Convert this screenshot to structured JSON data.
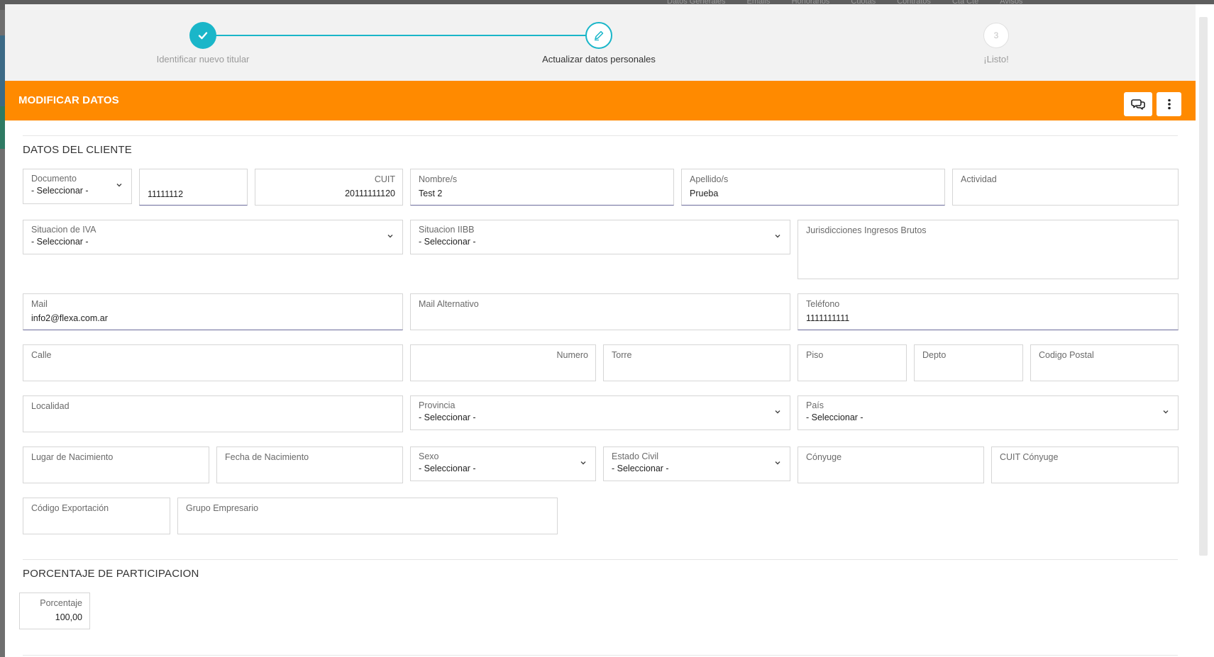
{
  "background": {
    "tabs": [
      "Datos Generales",
      "Emails",
      "Honorarios",
      "Cuotas",
      "Contratos",
      "Cta Cte",
      "Avisos"
    ]
  },
  "stepper": {
    "steps": [
      {
        "label": "Identificar nuevo titular",
        "state": "done"
      },
      {
        "label": "Actualizar datos personales",
        "state": "active"
      },
      {
        "label": "¡Listo!",
        "state": "pending",
        "number": "3"
      }
    ]
  },
  "header": {
    "title": "MODIFICAR DATOS",
    "color": "#ff8a00"
  },
  "client_section": {
    "title": "DATOS DEL CLIENTE",
    "documento": {
      "label": "Documento",
      "value": "- Seleccionar -"
    },
    "documento_numero": {
      "value": "11111112"
    },
    "cuit": {
      "label": "CUIT",
      "value": "20111111120"
    },
    "nombre": {
      "label": "Nombre/s",
      "value": "Test 2"
    },
    "apellido": {
      "label": "Apellido/s",
      "value": "Prueba"
    },
    "actividad": {
      "label": "Actividad",
      "value": ""
    },
    "situacion_iva": {
      "label": "Situacion de IVA",
      "value": "- Seleccionar -"
    },
    "situacion_iibb": {
      "label": "Situacion IIBB",
      "value": "- Seleccionar -"
    },
    "jurisdicciones": {
      "label": "Jurisdicciones Ingresos Brutos",
      "value": ""
    },
    "mail": {
      "label": "Mail",
      "value": "info2@flexa.com.ar"
    },
    "mail_alternativo": {
      "label": "Mail Alternativo",
      "value": ""
    },
    "telefono": {
      "label": "Teléfono",
      "value": "1111111111"
    },
    "calle": {
      "label": "Calle",
      "value": ""
    },
    "numero": {
      "label": "Numero",
      "value": ""
    },
    "torre": {
      "label": "Torre",
      "value": ""
    },
    "piso": {
      "label": "Piso",
      "value": ""
    },
    "depto": {
      "label": "Depto",
      "value": ""
    },
    "codigo_postal": {
      "label": "Codigo Postal",
      "value": ""
    },
    "localidad": {
      "label": "Localidad",
      "value": ""
    },
    "provincia": {
      "label": "Provincia",
      "value": "- Seleccionar -"
    },
    "pais": {
      "label": "País",
      "value": "- Seleccionar -"
    },
    "lugar_nacimiento": {
      "label": "Lugar de Nacimiento",
      "value": ""
    },
    "fecha_nacimiento": {
      "label": "Fecha de Nacimiento",
      "value": ""
    },
    "sexo": {
      "label": "Sexo",
      "value": "- Seleccionar -"
    },
    "estado_civil": {
      "label": "Estado Civil",
      "value": "- Seleccionar -"
    },
    "conyuge": {
      "label": "Cónyuge",
      "value": ""
    },
    "cuit_conyuge": {
      "label": "CUIT Cónyuge",
      "value": ""
    },
    "codigo_exportacion": {
      "label": "Código Exportación",
      "value": ""
    },
    "grupo_empresario": {
      "label": "Grupo Empresario",
      "value": ""
    }
  },
  "participation_section": {
    "title": "PORCENTAJE DE PARTICIPACION",
    "porcentaje": {
      "label": "Porcentaje",
      "value": "100,00"
    }
  },
  "colors": {
    "accent": "#1ab6c9",
    "header": "#ff8a00"
  }
}
